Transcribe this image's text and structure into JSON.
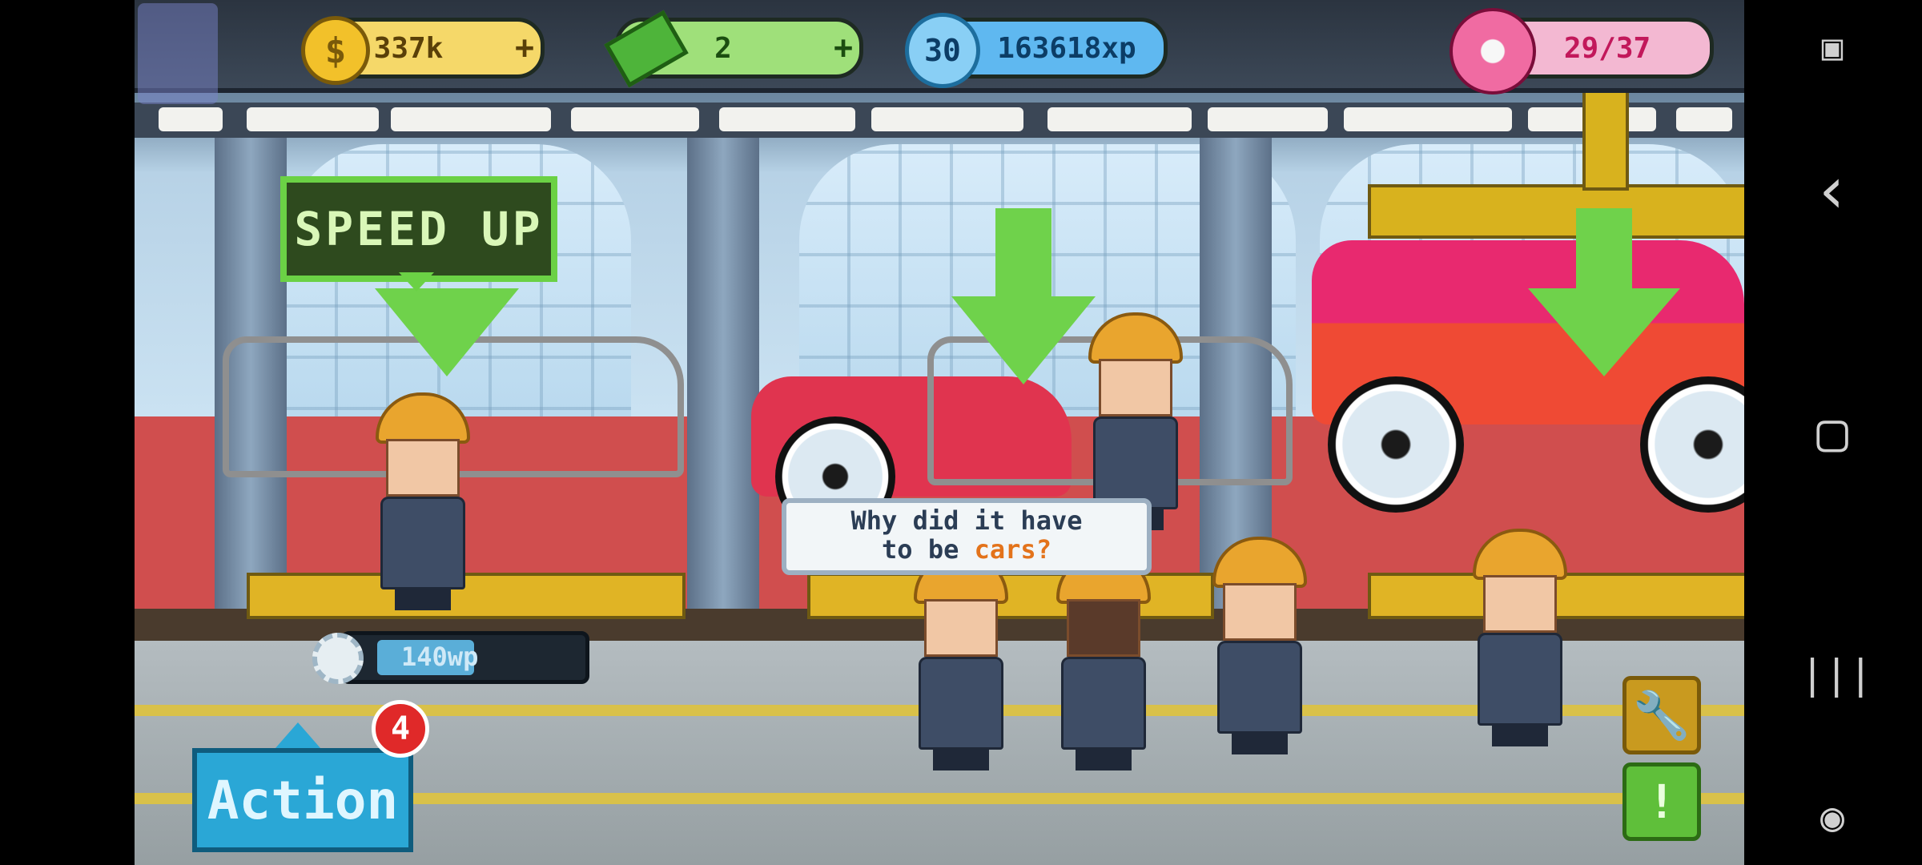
{
  "hud": {
    "coins": "337k",
    "cash": "2",
    "level": "30",
    "xp": "163618xp",
    "donuts": "29/37",
    "plus": "+"
  },
  "speed_up_label": "SPEED UP",
  "speech": {
    "line1": "Why did it have",
    "line2_prefix": "to be ",
    "line2_highlight": "cars?"
  },
  "workpower": {
    "label": "140wp",
    "fill_fraction": 0.55
  },
  "action": {
    "label": "Action",
    "badge": "4"
  },
  "side_buttons": {
    "tools": "🔧",
    "alert": "!"
  },
  "nav": {
    "back": "‹",
    "home": "▢",
    "recents": "|||"
  },
  "colors": {
    "speed_up_border": "#6bd145",
    "action_bg": "#2aa7d6",
    "badge": "#e02929"
  }
}
